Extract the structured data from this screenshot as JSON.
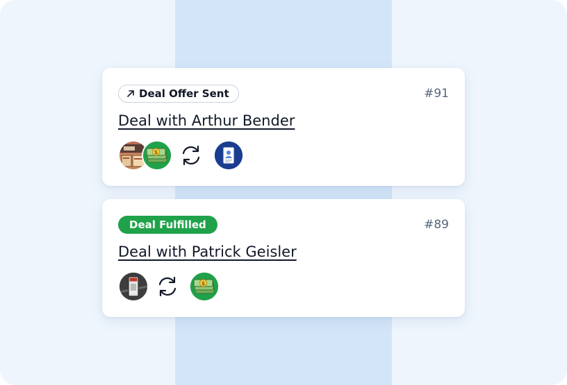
{
  "deals": [
    {
      "status_label": "Deal Offer Sent",
      "status_icon": "arrow-up-right-icon",
      "number": "#91",
      "title": "Deal with Arthur Bender",
      "items": [
        "card-game-thumbnail",
        "cash-icon",
        "sync-icon",
        "id-card-icon"
      ]
    },
    {
      "status_label": "Deal Fulfilled",
      "status_color": "#1fa24a",
      "number": "#89",
      "title": "Deal with Patrick Geisler",
      "items": [
        "graded-card-thumbnail",
        "sync-icon",
        "cash-icon"
      ]
    }
  ],
  "colors": {
    "background": "#eef5fd",
    "center_band": "#d3e6f8",
    "fulfilled_green": "#1fa24a",
    "number_gray": "#56657b",
    "id_blue": "#1a3d8f"
  }
}
